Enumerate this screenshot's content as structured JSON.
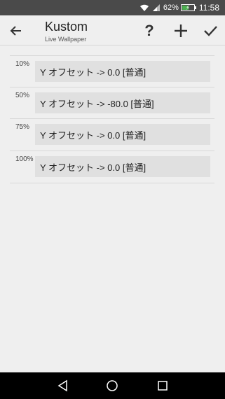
{
  "status_bar": {
    "battery_percent": "62%",
    "time": "11:58",
    "battery_level": 0.62
  },
  "app_bar": {
    "title": "Kustom",
    "subtitle": "Live Wallpaper",
    "help_label": "?"
  },
  "rows": [
    {
      "percent": "10%",
      "value": "Y オフセット -> 0.0 [普通]"
    },
    {
      "percent": "50%",
      "value": "Y オフセット -> -80.0 [普通]"
    },
    {
      "percent": "75%",
      "value": "Y オフセット -> 0.0 [普通]"
    },
    {
      "percent": "100%",
      "value": "Y オフセット -> 0.0 [普通]"
    }
  ],
  "colors": {
    "status_bar": "#4a4a4a",
    "background": "#efefef",
    "row_box": "#e0e0e0",
    "battery": "#4caf50",
    "nav_bar": "#000000"
  }
}
